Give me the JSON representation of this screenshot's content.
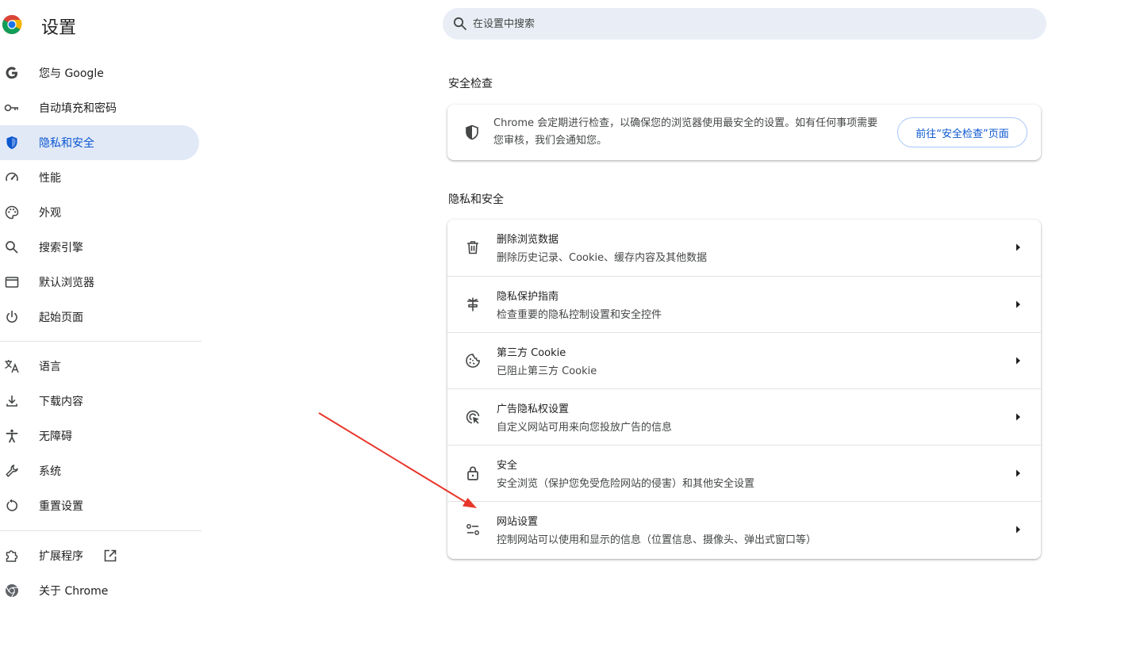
{
  "header": {
    "title": "设置",
    "logo_icon": "chrome-logo-icon",
    "search_placeholder": "在设置中搜索"
  },
  "sidebar": {
    "items": [
      {
        "label": "您与 Google",
        "icon": "google-g-icon"
      },
      {
        "label": "自动填充和密码",
        "icon": "key-icon"
      },
      {
        "label": "隐私和安全",
        "icon": "shield-icon",
        "active": true
      },
      {
        "label": "性能",
        "icon": "speedometer-icon"
      },
      {
        "label": "外观",
        "icon": "palette-icon"
      },
      {
        "label": "搜索引擎",
        "icon": "search-icon"
      },
      {
        "label": "默认浏览器",
        "icon": "browser-window-icon"
      },
      {
        "label": "起始页面",
        "icon": "power-icon"
      },
      {
        "label": "语言",
        "icon": "translate-icon"
      },
      {
        "label": "下载内容",
        "icon": "download-icon"
      },
      {
        "label": "无障碍",
        "icon": "accessibility-icon"
      },
      {
        "label": "系统",
        "icon": "wrench-icon"
      },
      {
        "label": "重置设置",
        "icon": "reset-icon"
      },
      {
        "label": "扩展程序",
        "icon": "puzzle-icon",
        "external_icon": "open-in-new-icon"
      },
      {
        "label": "关于 Chrome",
        "icon": "chrome-icon"
      }
    ]
  },
  "safety_check": {
    "title": "安全检查",
    "description": "Chrome 会定期进行检查，以确保您的浏览器使用最安全的设置。如有任何事项需要您审核，我们会通知您。",
    "button_label": "前往“安全检查”页面",
    "icon": "shield-half-icon"
  },
  "privacy": {
    "title": "隐私和安全",
    "rows": [
      {
        "title": "删除浏览数据",
        "subtitle": "删除历史记录、Cookie、缓存内容及其他数据",
        "icon": "trash-icon"
      },
      {
        "title": "隐私保护指南",
        "subtitle": "检查重要的隐私控制设置和安全控件",
        "icon": "privacy-guide-icon"
      },
      {
        "title": "第三方 Cookie",
        "subtitle": "已阻止第三方 Cookie",
        "icon": "cookie-icon"
      },
      {
        "title": "广告隐私权设置",
        "subtitle": "自定义网站可用来向您投放广告的信息",
        "icon": "ad-privacy-icon"
      },
      {
        "title": "安全",
        "subtitle": "安全浏览（保护您免受危险网站的侵害）和其他安全设置",
        "icon": "lock-icon"
      },
      {
        "title": "网站设置",
        "subtitle": "控制网站可以使用和显示的信息（位置信息、摄像头、弹出式窗口等）",
        "icon": "tune-icon"
      }
    ],
    "arrow_icon": "arrow-right-icon"
  },
  "colors": {
    "accent": "#0b57d0",
    "active_bg": "#e1e9f7",
    "search_bg": "#e9eef6",
    "annotation": "#e8362a"
  }
}
